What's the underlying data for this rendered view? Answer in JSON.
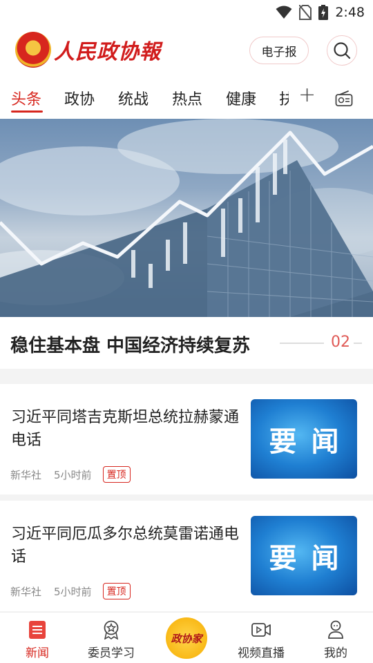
{
  "status_bar": {
    "time": "2:48",
    "icons": [
      "wifi-icon",
      "no-sim-icon",
      "battery-charging-icon"
    ]
  },
  "header": {
    "logo_text": "人民政协報",
    "epaper_label": "电子报",
    "search_icon": "search-icon"
  },
  "tabs": [
    {
      "label": "头条",
      "active": true
    },
    {
      "label": "政协",
      "active": false
    },
    {
      "label": "统战",
      "active": false
    },
    {
      "label": "热点",
      "active": false
    },
    {
      "label": "健康",
      "active": false
    },
    {
      "label": "扶",
      "active": false
    }
  ],
  "banner": {
    "caption": "稳住基本盘 中国经济持续复苏",
    "page": "02"
  },
  "news": [
    {
      "title": "习近平同塔吉克斯坦总统拉赫蒙通电话",
      "source": "新华社",
      "time": "5小时前",
      "badge": "置顶",
      "thumb_text": [
        "要",
        "闻"
      ]
    },
    {
      "title": "习近平同厄瓜多尔总统莫雷诺通电话",
      "source": "新华社",
      "time": "5小时前",
      "badge": "置顶",
      "thumb_text": [
        "要",
        "闻"
      ]
    }
  ],
  "bottom_nav": {
    "items": [
      {
        "label": "新闻",
        "icon": "news-icon",
        "active": true
      },
      {
        "label": "委员学习",
        "icon": "medal-icon",
        "active": false
      },
      {
        "label": "视频直播",
        "icon": "video-icon",
        "active": false
      },
      {
        "label": "我的",
        "icon": "profile-icon",
        "active": false
      }
    ],
    "center_label": "政协家"
  },
  "colors": {
    "accent": "#d7261e",
    "thumb_blue": "#1f7fd2",
    "center_yellow": "#f8b510"
  }
}
